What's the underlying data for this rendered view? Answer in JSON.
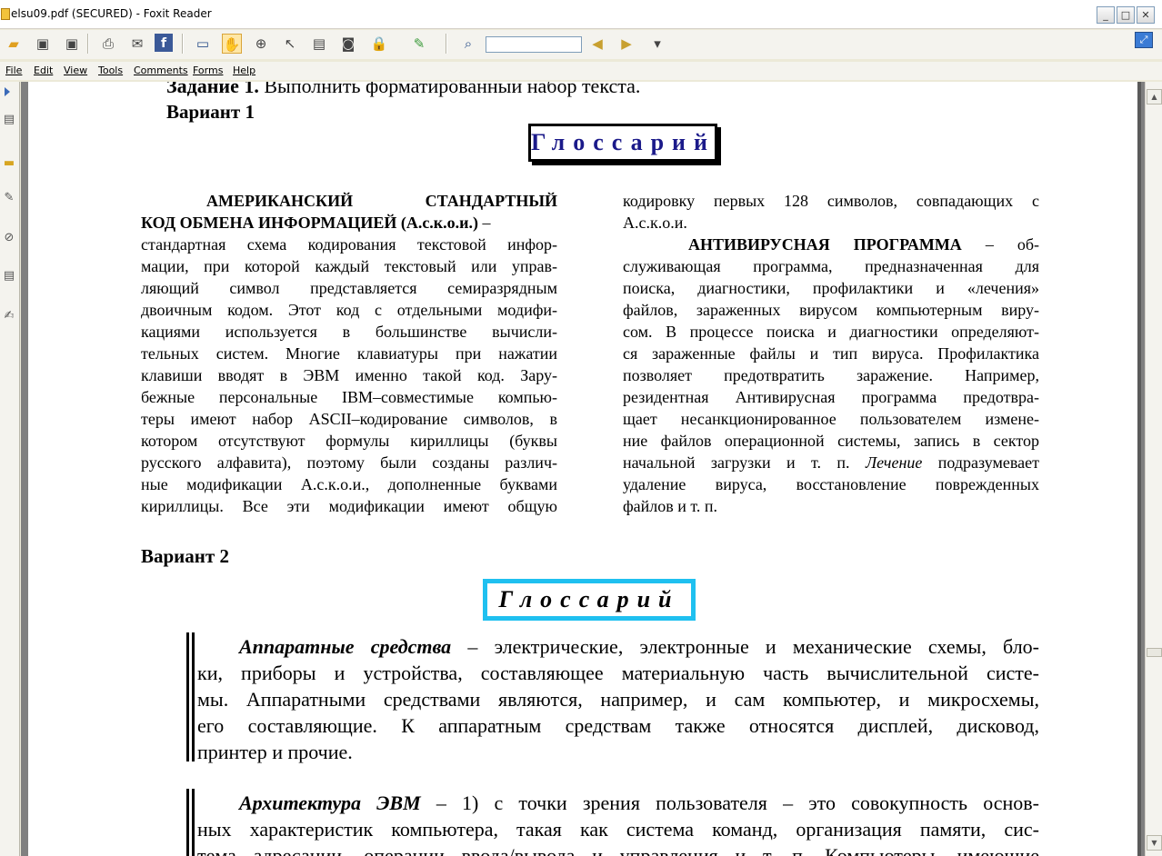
{
  "window": {
    "title": "elsu09.pdf (SECURED) - Foxit Reader",
    "controls": {
      "minimize": "_",
      "maximize": "□",
      "close": "✕"
    }
  },
  "toolbar": {
    "icons": [
      "open-icon",
      "save-icon",
      "save-as-icon",
      "print-icon",
      "email-icon",
      "facebook-icon",
      "fullscreen-icon",
      "hand-icon",
      "zoom-icon",
      "select-icon",
      "text-select-icon",
      "snapshot-icon",
      "rms-icon",
      "sign-icon",
      "find-icon"
    ],
    "search_value": ""
  },
  "menubar": {
    "items": [
      "File",
      "Edit",
      "View",
      "Tools",
      "Comments",
      "Forms",
      "Help"
    ]
  },
  "document": {
    "task_line": "Задание 1. Выполнить форматированный набор текста.",
    "task_bold": "Задание 1.",
    "task_rest": " Выполнить форматированный набор текста.",
    "variant1": "Вариант 1",
    "glossary1": "Глоссарий",
    "left_col": [
      "АМЕРИКАНСКИЙ СТАНДАРТНЫЙ",
      "КОД ОБМЕНА ИНФОРМАЦИЕЙ (А.с.к.о.и.) –",
      "стандартная схема кодирования текстовой инфор-",
      "мации, при которой каждый текстовый или управ-",
      "ляющий символ представляется семиразрядным",
      "двоичным кодом. Этот код с отдельными модифи-",
      "кациями используется в большинстве вычисли-",
      "тельных систем. Многие клавиатуры при нажатии",
      "клавиши вводят в ЭВМ именно такой код. Зару-",
      "бежные персональные IBM–совместимые компью-",
      "теры имеют набор ASCII–кодирование символов, в",
      "котором отсутствуют формулы кириллицы (буквы",
      "русского алфавита), поэтому были созданы различ-",
      "ные модификации А.с.к.о.и., дополненные буквами",
      "кириллицы. Все эти модификации имеют общую"
    ],
    "right_col": [
      "кодировку первых 128 символов, совпадающих с",
      "А.с.к.о.и.",
      "АНТИВИРУСНАЯ ПРОГРАММА – об-",
      "служивающая программа, предназначенная для",
      "поиска, диагностики, профилактики и «лечения»",
      "файлов, зараженных вирусом компьютерным виру-",
      "сом. В процессе поиска и диагностики определяют-",
      "ся зараженные файлы и тип вируса. Профилактика",
      "позволяет предотвратить заражение. Например,",
      "резидентная Антивирусная программа предотвра-",
      "щает несанкционированное пользователем измене-",
      "ние файлов операционной системы, запись в сектор",
      "начальной загрузки и т. п. Лечение подразумевает",
      "удаление вируса, восстановление поврежденных",
      "файлов и т. п."
    ],
    "variant2": "Вариант 2",
    "glossary2": "Глоссарий",
    "para1": [
      "Аппаратные средства – электрические, электронные и механические схемы, бло-",
      "ки, приборы и устройства, составляющее материальную часть вычислительной систе-",
      "мы. Аппаратными средствами являются, например, и сам компьютер, и микросхемы,",
      "его составляющие. К аппаратным средствам также относятся дисплей, дисковод,",
      "принтер и прочие."
    ],
    "para2": [
      "Архитектура ЭВМ – 1) с точки зрения пользователя – это совокупность основ-",
      "ных характеристик компьютера, такая как система команд, организация памяти, сис-",
      "тема адресации, операции ввода/вывода и управления и т. п. Компьютеры, имеющие"
    ]
  }
}
